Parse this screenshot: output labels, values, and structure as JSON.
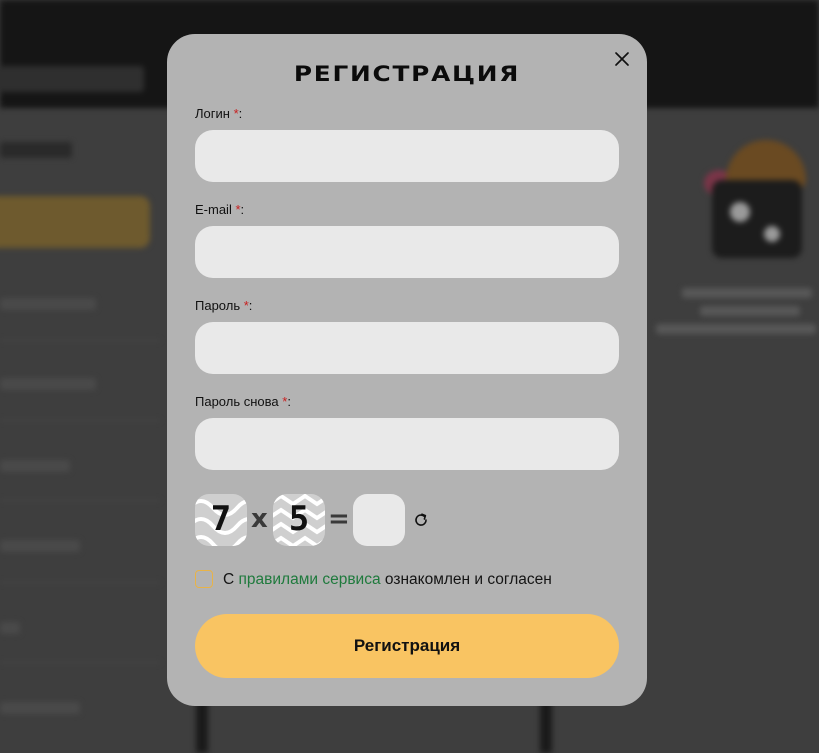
{
  "modal": {
    "title": "РЕГИСТРАЦИЯ",
    "close_icon": "close-icon"
  },
  "fields": [
    {
      "label": "Логин",
      "required_mark": "*",
      "suffix": ":",
      "value": "",
      "type": "text"
    },
    {
      "label": "E-mail",
      "required_mark": "*",
      "suffix": ":",
      "value": "",
      "type": "email"
    },
    {
      "label": "Пароль",
      "required_mark": "*",
      "suffix": ":",
      "value": "",
      "type": "password"
    },
    {
      "label": "Пароль снова",
      "required_mark": "*",
      "suffix": ":",
      "value": "",
      "type": "password"
    }
  ],
  "captcha": {
    "operand1": "7",
    "operator": "x",
    "operand2": "5",
    "equals": "=",
    "answer": "",
    "refresh_icon": "refresh-icon"
  },
  "agreement": {
    "checked": false,
    "prefix": "С",
    "link_text": "правилами сервиса",
    "suffix": "ознакомлен и согласен"
  },
  "submit": {
    "label": "Регистрация"
  },
  "colors": {
    "accent": "#f9c462",
    "modal_bg": "#b3b3b3",
    "input_bg": "#e9e9e9",
    "required": "#c81e1e",
    "link": "#1f7a3d",
    "checkbox_border": "#e8b347"
  }
}
